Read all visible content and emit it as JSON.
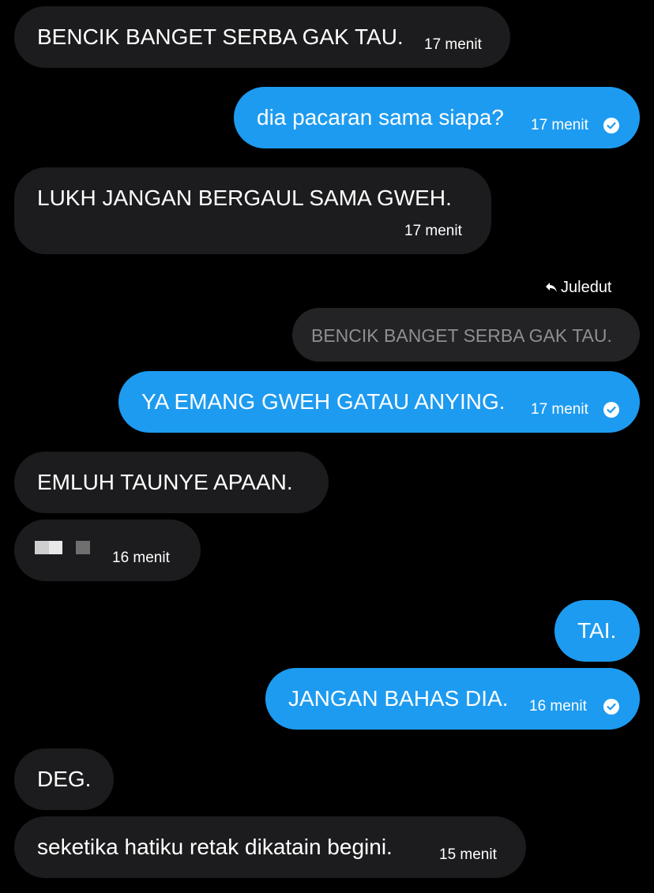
{
  "messages": [
    {
      "id": "m1",
      "dir": "in",
      "text": "BENCIK BANGET SERBA GAK TAU.",
      "time": "17 menit"
    },
    {
      "id": "m2",
      "dir": "out",
      "text": "dia pacaran sama siapa?",
      "time": "17 menit",
      "read": true
    },
    {
      "id": "m3",
      "dir": "in",
      "text": "LUKH JANGAN BERGAUL SAMA GWEH.",
      "time": "17 menit"
    },
    {
      "id": "m4",
      "dir": "out",
      "reply_to_name": "Juledut",
      "reply_to_text": "BENCIK BANGET SERBA GAK TAU.",
      "text": "YA EMANG GWEH GATAU ANYING.",
      "time": "17 menit",
      "read": true
    },
    {
      "id": "m5",
      "dir": "in",
      "text": "EMLUH TAUNYE APAAN."
    },
    {
      "id": "m6",
      "dir": "in",
      "text": "",
      "time": "16 menit",
      "redacted": true
    },
    {
      "id": "m7",
      "dir": "out",
      "text": "TAI."
    },
    {
      "id": "m8",
      "dir": "out",
      "text": "JANGAN BAHAS DIA.",
      "time": "16 menit",
      "read": true
    },
    {
      "id": "m9",
      "dir": "in",
      "text": "DEG."
    },
    {
      "id": "m10",
      "dir": "in",
      "text": "seketika hatiku retak dikatain begini.",
      "time": "15 menit"
    }
  ],
  "icons": {
    "read": "check-circle-icon",
    "reply": "reply-arrow-icon"
  },
  "colors": {
    "background": "#000000",
    "incoming": "#1c1c1e",
    "outgoing": "#1d9bf0",
    "quoted": "#232325"
  }
}
